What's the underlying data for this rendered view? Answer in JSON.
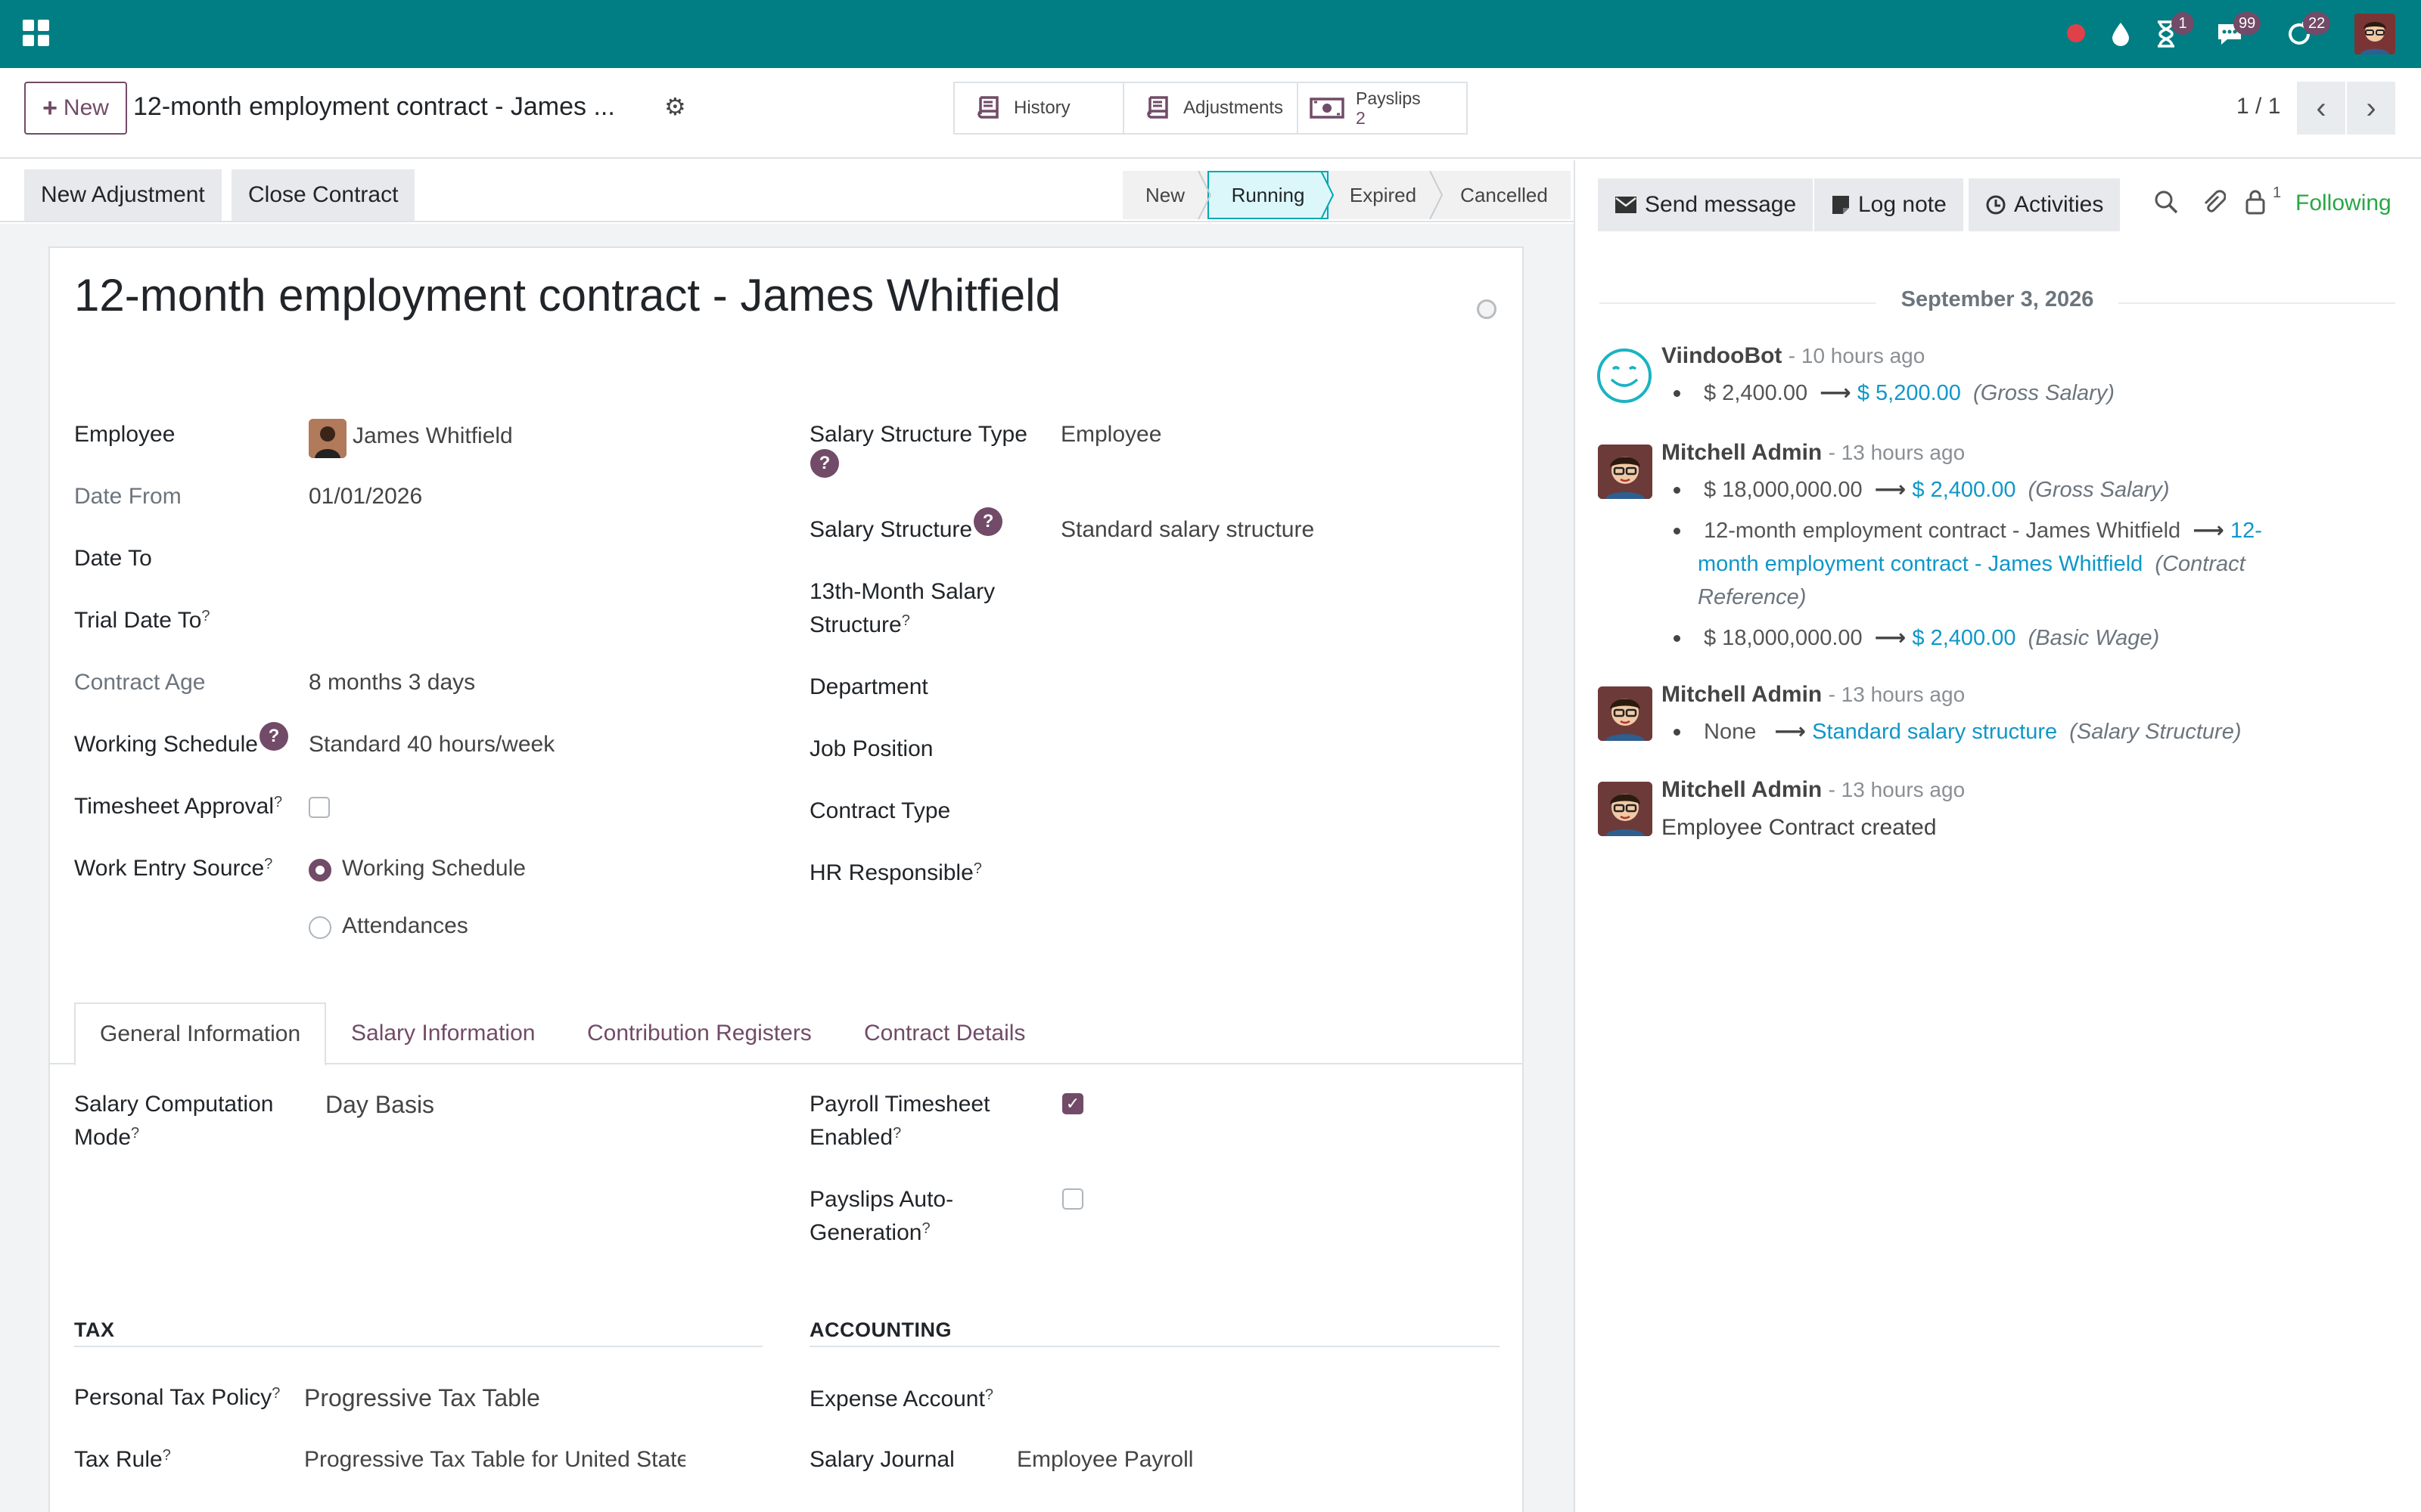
{
  "topbar": {
    "bg_color": "#017e84",
    "badges": {
      "activities": "1",
      "messages": "99",
      "updates": "22"
    }
  },
  "control_panel": {
    "new_label": "New",
    "breadcrumb": "12-month employment contract - James ...",
    "smart_buttons": {
      "history": "History",
      "adjustments": "Adjustments",
      "payslips_label": "Payslips",
      "payslips_count": "2"
    },
    "pager": "1 / 1"
  },
  "statusbar": {
    "new_adjustment": "New Adjustment",
    "close_contract": "Close Contract",
    "stages": [
      "New",
      "Running",
      "Expired",
      "Cancelled"
    ],
    "active_stage": "Running"
  },
  "form": {
    "title": "12-month employment contract - James Whitfield",
    "left": {
      "employee_label": "Employee",
      "employee_value": "James Whitfield",
      "date_from_label": "Date From",
      "date_from_value": "01/01/2026",
      "date_to_label": "Date To",
      "trial_date_to_label": "Trial Date To",
      "contract_age_label": "Contract Age",
      "contract_age_value": "8 months 3 days",
      "working_schedule_label": "Working Schedule",
      "working_schedule_value": "Standard 40 hours/week",
      "timesheet_approval_label": "Timesheet Approval",
      "work_entry_source_label": "Work Entry Source",
      "work_entry_options": [
        "Working Schedule",
        "Attendances"
      ]
    },
    "right": {
      "salary_structure_type_label": "Salary Structure Type",
      "salary_structure_type_value": "Employee",
      "salary_structure_label": "Salary Structure",
      "salary_structure_value": "Standard salary structure",
      "thirteenth_label_1": "13th-Month Salary",
      "thirteenth_label_2": "Structure",
      "department_label": "Department",
      "job_position_label": "Job Position",
      "contract_type_label": "Contract Type",
      "hr_responsible_label": "HR Responsible"
    },
    "help_mark": "?",
    "sup_mark": "?"
  },
  "notebook": {
    "tabs": [
      "General Information",
      "Salary Information",
      "Contribution Registers",
      "Contract Details"
    ],
    "active_tab": "General Information",
    "general": {
      "salary_mode_label_1": "Salary Computation",
      "salary_mode_label_2": "Mode",
      "salary_mode_value": "Day Basis",
      "payroll_ts_label_1": "Payroll Timesheet",
      "payroll_ts_label_2": "Enabled",
      "payroll_ts_checked": true,
      "payslips_auto_label_1": "Payslips Auto-",
      "payslips_auto_label_2": "Generation",
      "payslips_auto_checked": false,
      "tax_title": "TAX",
      "accounting_title": "ACCOUNTING",
      "personal_tax_label": "Personal Tax Policy",
      "personal_tax_value": "Progressive Tax Table",
      "tax_rule_label": "Tax Rule",
      "tax_rule_value": "Progressive Tax Table for United State",
      "expense_account_label": "Expense Account",
      "salary_journal_label": "Salary Journal",
      "salary_journal_value": "Employee Payroll"
    }
  },
  "chatter": {
    "send_message": "Send message",
    "log_note": "Log note",
    "activities": "Activities",
    "followers_count": "1",
    "following": "Following",
    "date": "September 3, 2026",
    "messages": [
      {
        "author": "ViindooBot",
        "ago": "- 10 hours ago",
        "changes": [
          {
            "old": "$ 2,400.00",
            "new": "$ 5,200.00",
            "field": "(Gross Salary)"
          }
        ]
      },
      {
        "author": "Mitchell Admin",
        "ago": "- 13 hours ago",
        "changes": [
          {
            "old": "$ 18,000,000.00",
            "new": "$ 2,400.00",
            "field": "(Gross Salary)"
          },
          {
            "old": "12-month employment contract - James Whitfield",
            "new_1": "12-",
            "new_2": "month employment contract - James Whitfield",
            "field_1": "(Contract",
            "field_2": "Reference)"
          },
          {
            "old": "$ 18,000,000.00",
            "new": "$ 2,400.00",
            "field": "(Basic Wage)"
          }
        ]
      },
      {
        "author": "Mitchell Admin",
        "ago": "- 13 hours ago",
        "changes": [
          {
            "old": "None",
            "new": "Standard salary structure",
            "field": "(Salary Structure)"
          }
        ]
      },
      {
        "author": "Mitchell Admin",
        "ago": "- 13 hours ago",
        "body": "Employee Contract created"
      }
    ]
  }
}
